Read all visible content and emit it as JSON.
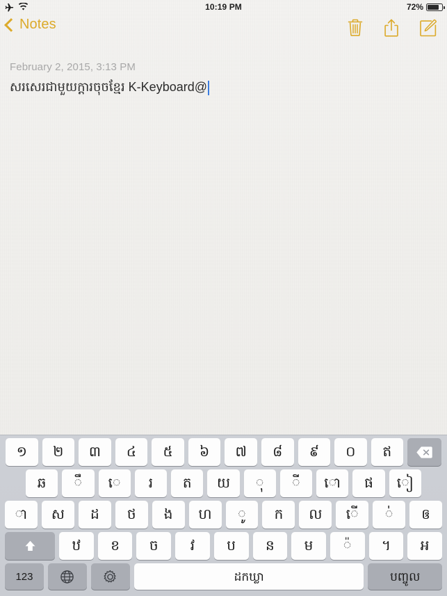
{
  "status_bar": {
    "airplane_icon": "airplane-icon",
    "wifi_icon": "wifi-icon",
    "time": "10:19 PM",
    "battery_percent": "72%",
    "battery_level": 72
  },
  "nav_bar": {
    "back_label": "Notes",
    "back_icon": "chevron-left-icon",
    "actions": [
      {
        "name": "trash-icon",
        "label": "Delete"
      },
      {
        "name": "share-icon",
        "label": "Share"
      },
      {
        "name": "compose-icon",
        "label": "Compose"
      }
    ],
    "accent_color": "#dcaa2a"
  },
  "note": {
    "date": "February 2, 2015, 3:13 PM",
    "text": "សរសេរជាមួយក្ដារចុចខ្មែរ K-Keyboard@",
    "caret_color": "#3b7de0"
  },
  "keyboard": {
    "language": "Khmer",
    "rows": [
      {
        "id": "row-1",
        "keys": [
          {
            "label": "១",
            "name": "key-khmer-1"
          },
          {
            "label": "២",
            "name": "key-khmer-2"
          },
          {
            "label": "៣",
            "name": "key-khmer-3"
          },
          {
            "label": "៤",
            "name": "key-khmer-4"
          },
          {
            "label": "៥",
            "name": "key-khmer-5"
          },
          {
            "label": "៦",
            "name": "key-khmer-6"
          },
          {
            "label": "៧",
            "name": "key-khmer-7"
          },
          {
            "label": "៨",
            "name": "key-khmer-8"
          },
          {
            "label": "៩",
            "name": "key-khmer-9"
          },
          {
            "label": "០",
            "name": "key-khmer-0"
          },
          {
            "label": "ឥ",
            "name": "key-khmer-ei"
          }
        ],
        "backspace": {
          "label": "⌫",
          "name": "backspace-key"
        }
      },
      {
        "id": "row-2",
        "keys": [
          {
            "label": "ឆ",
            "name": "key-khmer-cha"
          },
          {
            "label": "ឹ",
            "name": "key-khmer-vowel-y"
          },
          {
            "label": "េ",
            "name": "key-khmer-vowel-e"
          },
          {
            "label": "រ",
            "name": "key-khmer-ro"
          },
          {
            "label": "ត",
            "name": "key-khmer-ta"
          },
          {
            "label": "យ",
            "name": "key-khmer-yo"
          },
          {
            "label": "ុ",
            "name": "key-khmer-vowel-u"
          },
          {
            "label": "ី",
            "name": "key-khmer-vowel-ii"
          },
          {
            "label": "ោ",
            "name": "key-khmer-vowel-ao"
          },
          {
            "label": "ផ",
            "name": "key-khmer-pha"
          },
          {
            "label": "ៀ",
            "name": "key-khmer-vowel-ie"
          }
        ]
      },
      {
        "id": "row-3",
        "keys": [
          {
            "label": "ា",
            "name": "key-khmer-vowel-aa"
          },
          {
            "label": "ស",
            "name": "key-khmer-sa"
          },
          {
            "label": "ដ",
            "name": "key-khmer-da"
          },
          {
            "label": "ថ",
            "name": "key-khmer-tha"
          },
          {
            "label": "ង",
            "name": "key-khmer-ngo"
          },
          {
            "label": "ហ",
            "name": "key-khmer-ha"
          },
          {
            "label": "ូ",
            "name": "key-khmer-vowel-uu"
          },
          {
            "label": "ក",
            "name": "key-khmer-ka"
          },
          {
            "label": "ល",
            "name": "key-khmer-lo"
          },
          {
            "label": "ើ",
            "name": "key-khmer-vowel-ae"
          },
          {
            "label": "់",
            "name": "key-khmer-bantoc"
          },
          {
            "label": "ឲ",
            "name": "key-khmer-aov"
          }
        ]
      },
      {
        "id": "row-4",
        "shift": {
          "label": "⇧",
          "name": "shift-key"
        },
        "keys": [
          {
            "label": "ឋ",
            "name": "key-khmer-ttha"
          },
          {
            "label": "ខ",
            "name": "key-khmer-kha"
          },
          {
            "label": "ច",
            "name": "key-khmer-cha2"
          },
          {
            "label": "វ",
            "name": "key-khmer-vo"
          },
          {
            "label": "ប",
            "name": "key-khmer-ba"
          },
          {
            "label": "ន",
            "name": "key-khmer-no"
          },
          {
            "label": "ម",
            "name": "key-khmer-mo"
          },
          {
            "label": "៉",
            "name": "key-khmer-musikatoan"
          },
          {
            "label": "។",
            "name": "key-khmer-khan"
          },
          {
            "label": "ឣ",
            "name": "key-khmer-qa"
          }
        ]
      }
    ],
    "bottom_row": {
      "numbers_key": {
        "label": "123",
        "name": "numbers-key"
      },
      "globe_key": {
        "label": "globe-icon",
        "name": "globe-key"
      },
      "settings_key": {
        "label": "gear-icon",
        "name": "keyboard-settings-key"
      },
      "space_key": {
        "label": "ដកឃ្លា",
        "name": "space-key"
      },
      "enter_key": {
        "label": "បញ្ចូល",
        "name": "return-key"
      }
    }
  }
}
